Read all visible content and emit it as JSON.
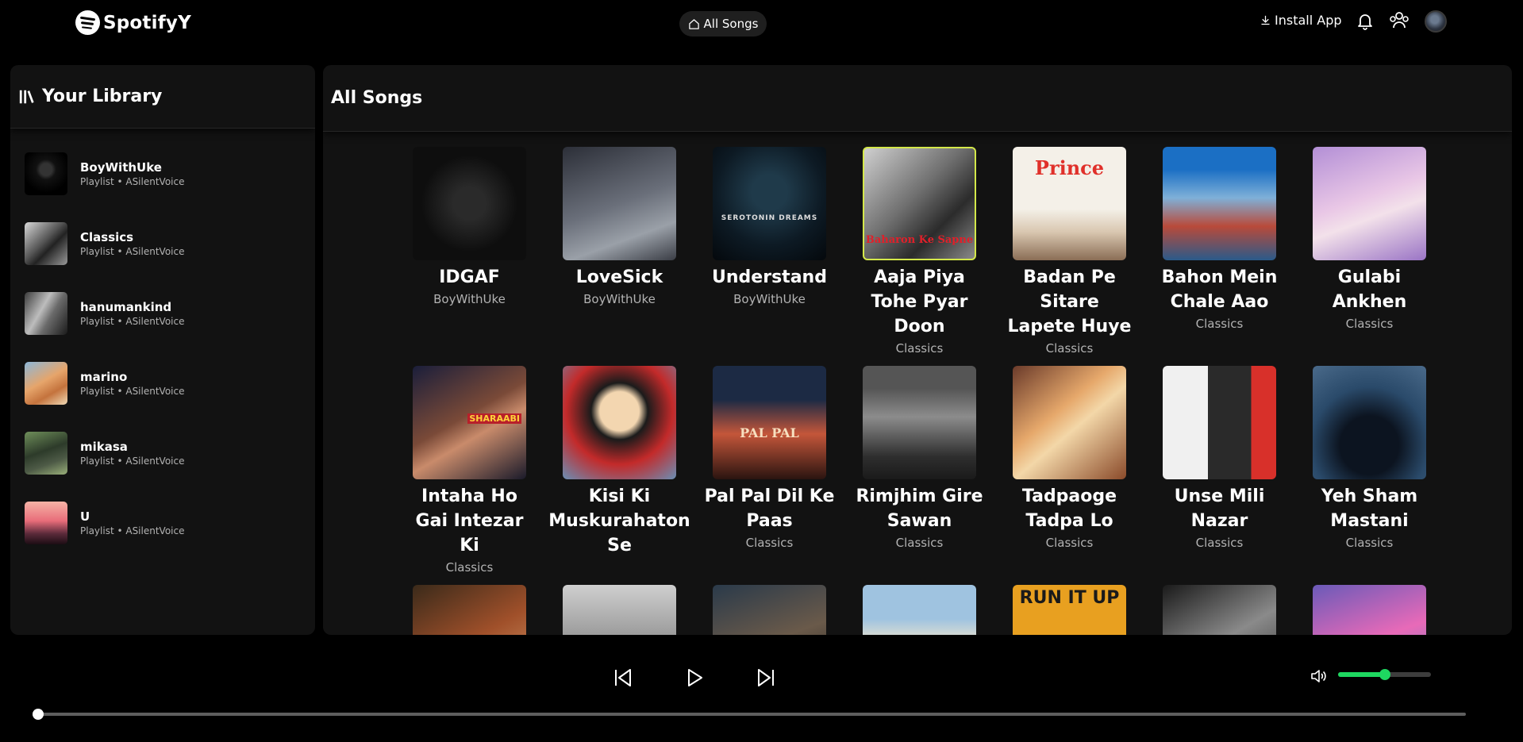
{
  "app": {
    "name": "SpotifyY"
  },
  "header": {
    "center_tab": "All Songs",
    "install_label": "Install App"
  },
  "library": {
    "title": "Your Library",
    "items": [
      {
        "name": "BoyWithUke",
        "meta": "Playlist • ASilentVoice",
        "icon": "masked-figure"
      },
      {
        "name": "Classics",
        "meta": "Playlist • ASilentVoice",
        "icon": "vintage-couple-bw"
      },
      {
        "name": "hanumankind",
        "meta": "Playlist • ASilentVoice",
        "icon": "portrait-bw"
      },
      {
        "name": "marino",
        "meta": "Playlist • ASilentVoice",
        "icon": "fox-illustration"
      },
      {
        "name": "mikasa",
        "meta": "Playlist • ASilentVoice",
        "icon": "anime-girl"
      },
      {
        "name": "U",
        "meta": "Playlist • ASilentVoice",
        "icon": "sunset-heart"
      }
    ]
  },
  "main": {
    "title": "All Songs",
    "songs": [
      {
        "title": "IDGAF",
        "artist": "BoyWithUke"
      },
      {
        "title": "LoveSick",
        "artist": "BoyWithUke"
      },
      {
        "title": "Understand",
        "artist": "BoyWithUke"
      },
      {
        "title": "Aaja Piya Tohe Pyar Doon",
        "artist": "Classics"
      },
      {
        "title": "Badan Pe Sitare Lapete Huye",
        "artist": "Classics"
      },
      {
        "title": "Bahon Mein Chale Aao",
        "artist": "Classics"
      },
      {
        "title": "Gulabi Ankhen",
        "artist": "Classics"
      },
      {
        "title": "Intaha Ho Gai Intezar Ki",
        "artist": "Classics"
      },
      {
        "title": "Kisi Ki Muskurahaton Se",
        "artist": ""
      },
      {
        "title": "Pal Pal Dil Ke Paas",
        "artist": "Classics"
      },
      {
        "title": "Rimjhim Gire Sawan",
        "artist": "Classics"
      },
      {
        "title": "Tadpaoge Tadpa Lo",
        "artist": "Classics"
      },
      {
        "title": "Unse Mili Nazar",
        "artist": "Classics"
      },
      {
        "title": "Yeh Sham Mastani",
        "artist": "Classics"
      },
      {
        "title": "",
        "artist": ""
      },
      {
        "title": "",
        "artist": ""
      },
      {
        "title": "",
        "artist": ""
      },
      {
        "title": "",
        "artist": ""
      },
      {
        "title": "",
        "artist": ""
      },
      {
        "title": "",
        "artist": ""
      },
      {
        "title": "",
        "artist": ""
      }
    ],
    "cover_text": {
      "understand": "SEROTONIN DREAMS",
      "aaja": "Baharon Ke Sapne",
      "badan": "Prince",
      "intaha": "SHARAABI",
      "pal": "PAL PAL",
      "runitup": "RUN IT UP"
    }
  },
  "player": {
    "volume": 0.5,
    "progress": 0.0
  },
  "colors": {
    "accent": "#1ed760",
    "panel": "#121212",
    "background": "#000000"
  }
}
